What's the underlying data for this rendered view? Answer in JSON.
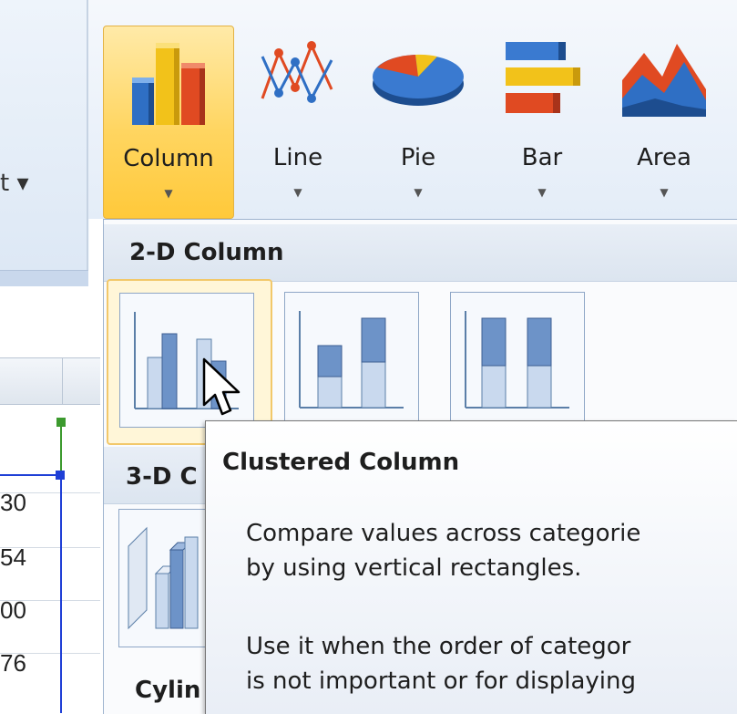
{
  "ribbon": {
    "left_label": "t ▾",
    "buttons": [
      {
        "id": "column",
        "label": "Column",
        "icon": "column-chart-icon"
      },
      {
        "id": "line",
        "label": "Line",
        "icon": "line-chart-icon"
      },
      {
        "id": "pie",
        "label": "Pie",
        "icon": "pie-chart-icon"
      },
      {
        "id": "bar",
        "label": "Bar",
        "icon": "bar-chart-icon"
      },
      {
        "id": "area",
        "label": "Area",
        "icon": "area-chart-icon"
      }
    ],
    "dropdown_arrow": "▼"
  },
  "sheet": {
    "values": [
      "30",
      "54",
      "00",
      "76"
    ]
  },
  "gallery": {
    "section_2d": "2-D Column",
    "section_3d": "3-D C",
    "section_cyl": "Cylin"
  },
  "tooltip": {
    "title": "Clustered Column",
    "line1": "Compare values across categorie",
    "line2": "by using vertical rectangles.",
    "line3": "Use it when the order of categor",
    "line4": "is not important or for displaying"
  },
  "colors": {
    "selected_fill": "#ffd560",
    "selected_border": "#e3b243",
    "selection_blue": "#1f3fd6",
    "handle_green": "#3c9a2e"
  }
}
